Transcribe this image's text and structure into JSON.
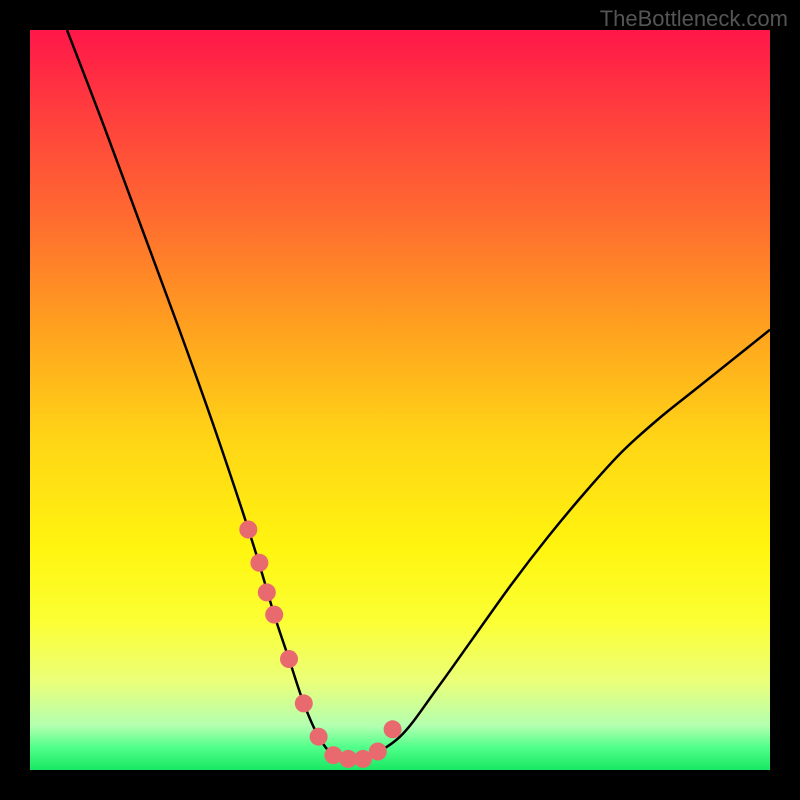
{
  "watermark": "TheBottleneck.com",
  "colors": {
    "background": "#000000",
    "curve_stroke": "#000000",
    "marker_fill": "#e86a6f",
    "gradient_top": "#ff1749",
    "gradient_bottom": "#18e763"
  },
  "chart_data": {
    "type": "line",
    "title": "",
    "xlabel": "",
    "ylabel": "",
    "xlim": [
      0,
      100
    ],
    "ylim": [
      0,
      100
    ],
    "series": [
      {
        "name": "bottleneck-curve",
        "x": [
          5,
          10,
          15,
          20,
          25,
          30,
          33,
          35,
          37,
          39,
          41,
          43,
          45,
          50,
          55,
          60,
          65,
          70,
          75,
          80,
          85,
          90,
          95,
          100
        ],
        "values": [
          100,
          87,
          73.5,
          60,
          46,
          31,
          21,
          15,
          9,
          4.5,
          2,
          1.5,
          1.5,
          4.5,
          11,
          18,
          25,
          31.5,
          37.5,
          43,
          47.5,
          51.5,
          55.5,
          59.5
        ]
      }
    ],
    "markers": {
      "name": "highlight-dots",
      "x": [
        29.5,
        31,
        32,
        33,
        35,
        37,
        39,
        41,
        43,
        45,
        47,
        49
      ],
      "values": [
        32.5,
        28,
        24,
        21,
        15,
        9,
        4.5,
        2,
        1.5,
        1.5,
        2.5,
        5.5
      ]
    },
    "annotations": []
  }
}
